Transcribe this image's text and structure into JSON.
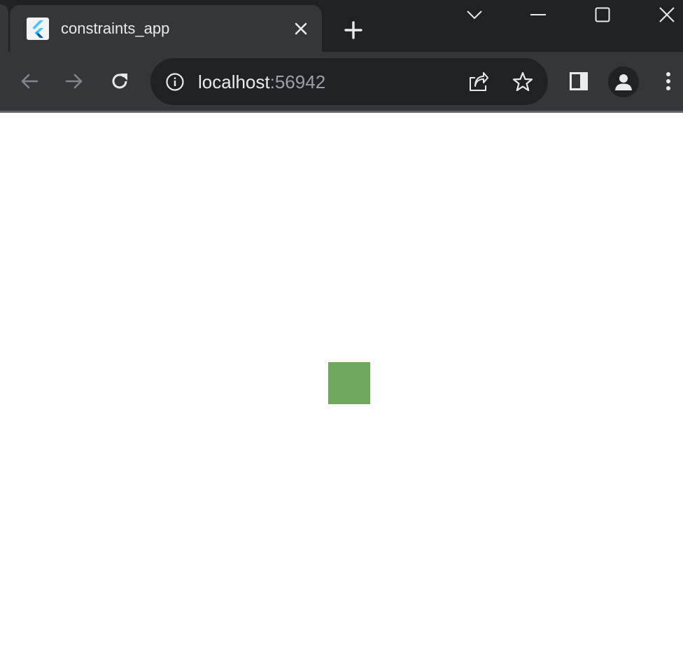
{
  "tab": {
    "title": "constraints_app",
    "favicon": "flutter-logo-icon",
    "close_icon": "close-icon"
  },
  "tabstrip": {
    "new_tab_icon": "plus-icon",
    "tab_search_icon": "chevron-down-icon",
    "minimize_icon": "minimize-icon",
    "maximize_icon": "maximize-icon",
    "close_window_icon": "close-icon"
  },
  "toolbar": {
    "back_icon": "arrow-left-icon",
    "forward_icon": "arrow-right-icon",
    "reload_icon": "reload-icon",
    "side_panel_icon": "side-panel-icon",
    "profile_icon": "person-icon",
    "menu_icon": "kebab-menu-icon"
  },
  "omnibox": {
    "info_icon": "info-icon",
    "host": "localhost",
    "port": ":56942",
    "share_icon": "share-icon",
    "bookmark_icon": "star-icon"
  },
  "page": {
    "box_color": "#6faa5c"
  },
  "colors": {
    "tabstrip_bg": "#202124",
    "toolbar_bg": "#35363a",
    "omnibox_bg": "#202124",
    "text_primary": "#e8eaed",
    "text_secondary": "#9aa0a6",
    "page_bg": "#ffffff"
  }
}
